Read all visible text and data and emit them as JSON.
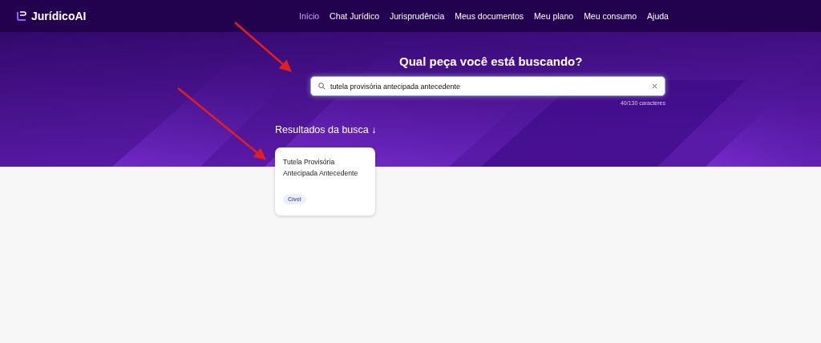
{
  "brand": {
    "name": "JurídicoAI"
  },
  "nav": [
    {
      "label": "Início",
      "selected": true
    },
    {
      "label": "Chat Jurídico",
      "selected": false
    },
    {
      "label": "Jurisprudência",
      "selected": false
    },
    {
      "label": "Meus documentos",
      "selected": false
    },
    {
      "label": "Meu plano",
      "selected": false
    },
    {
      "label": "Meu consumo",
      "selected": false
    },
    {
      "label": "Ajuda",
      "selected": false
    }
  ],
  "hero": {
    "title": "Qual peça você está buscando?"
  },
  "search": {
    "value": "tutela provisória antecipada antecedente",
    "counter": "40/130 caracteres"
  },
  "results": {
    "heading": "Resultados da busca ↓",
    "cards": [
      {
        "title": "Tutela Provisória Antecipada Antecedente",
        "tag": "Cível"
      }
    ]
  }
}
